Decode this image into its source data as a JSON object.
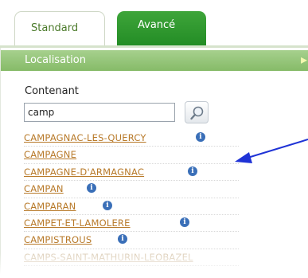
{
  "tabs": [
    {
      "label": "Standard",
      "active": true
    },
    {
      "label": "Avancé",
      "active": false
    }
  ],
  "section": {
    "title": "Localisation"
  },
  "search": {
    "label": "Contenant",
    "value": "camp"
  },
  "results": [
    {
      "name": "CAMPAGNAC-LES-QUERCY",
      "info": true
    },
    {
      "name": "CAMPAGNE",
      "info": false
    },
    {
      "name": "CAMPAGNE-D'ARMAGNAC",
      "info": true
    },
    {
      "name": "CAMPAN",
      "info": true
    },
    {
      "name": "CAMPARAN",
      "info": true
    },
    {
      "name": "CAMPET-ET-LAMOLERE",
      "info": true
    },
    {
      "name": "CAMPISTROUS",
      "info": true
    },
    {
      "name": "CAMPS-SAINT-MATHURIN-LEOBAZEL",
      "info": false
    }
  ],
  "icons": {
    "info": "info-icon",
    "search": "magnifier-icon",
    "collapse": "collapse-icon",
    "annotation": "arrow-icon"
  },
  "colors": {
    "tab_active_green": "#2e9a2e",
    "header_green": "#96c57a",
    "link": "#b87a2a",
    "info_blue": "#3a6fb8",
    "arrow_blue": "#1f33d6"
  }
}
